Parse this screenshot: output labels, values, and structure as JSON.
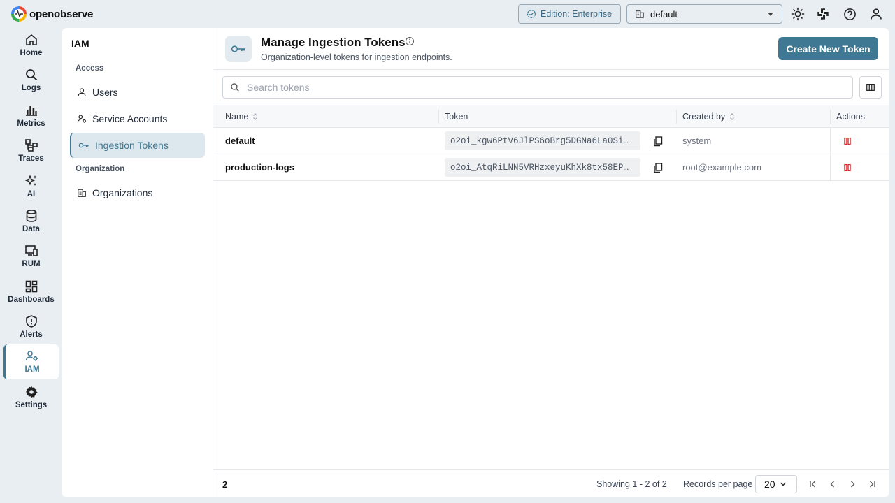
{
  "app": {
    "logo_text": "openobserve"
  },
  "topbar": {
    "edition_label": "Edition: Enterprise",
    "org_selected": "default",
    "icons": [
      "theme-toggle-icon",
      "slack-icon",
      "help-icon",
      "user-icon"
    ]
  },
  "rail": {
    "items": [
      {
        "label": "Home",
        "icon": "home-icon"
      },
      {
        "label": "Logs",
        "icon": "search-icon"
      },
      {
        "label": "Metrics",
        "icon": "bar-chart-icon"
      },
      {
        "label": "Traces",
        "icon": "traces-icon"
      },
      {
        "label": "AI",
        "icon": "sparkle-icon"
      },
      {
        "label": "Data",
        "icon": "database-icon"
      },
      {
        "label": "RUM",
        "icon": "devices-icon"
      },
      {
        "label": "Dashboards",
        "icon": "dashboard-icon"
      },
      {
        "label": "Alerts",
        "icon": "alert-shield-icon"
      },
      {
        "label": "IAM",
        "icon": "iam-icon",
        "active": true
      },
      {
        "label": "Settings",
        "icon": "gear-icon"
      }
    ]
  },
  "sidebar": {
    "title": "IAM",
    "section_access": "Access",
    "section_organization": "Organization",
    "items": {
      "users": "Users",
      "service_accounts": "Service Accounts",
      "ingestion_tokens": "Ingestion Tokens",
      "organizations": "Organizations"
    }
  },
  "page": {
    "title": "Manage Ingestion Tokens",
    "subtitle": "Organization-level tokens for ingestion endpoints.",
    "create_button": "Create New Token",
    "search_placeholder": "Search tokens"
  },
  "table": {
    "columns": {
      "name": "Name",
      "token": "Token",
      "created_by": "Created by",
      "actions": "Actions"
    },
    "rows": [
      {
        "name": "default",
        "token": "o2oi_kgw6PtV6JlPS6oBrg5DGNa6La0Si…",
        "created_by": "system"
      },
      {
        "name": "production-logs",
        "token": "o2oi_AtqRiLNN5VRHzxeyuKhXk8tx58EP…",
        "created_by": "root@example.com"
      }
    ]
  },
  "footer": {
    "count": "2",
    "showing": "Showing 1 - 2 of 2",
    "records_per_page_label": "Records per page",
    "records_per_page_value": "20"
  },
  "colors": {
    "accent": "#3e7893",
    "danger": "#dc2626",
    "background": "#e8eef2"
  }
}
